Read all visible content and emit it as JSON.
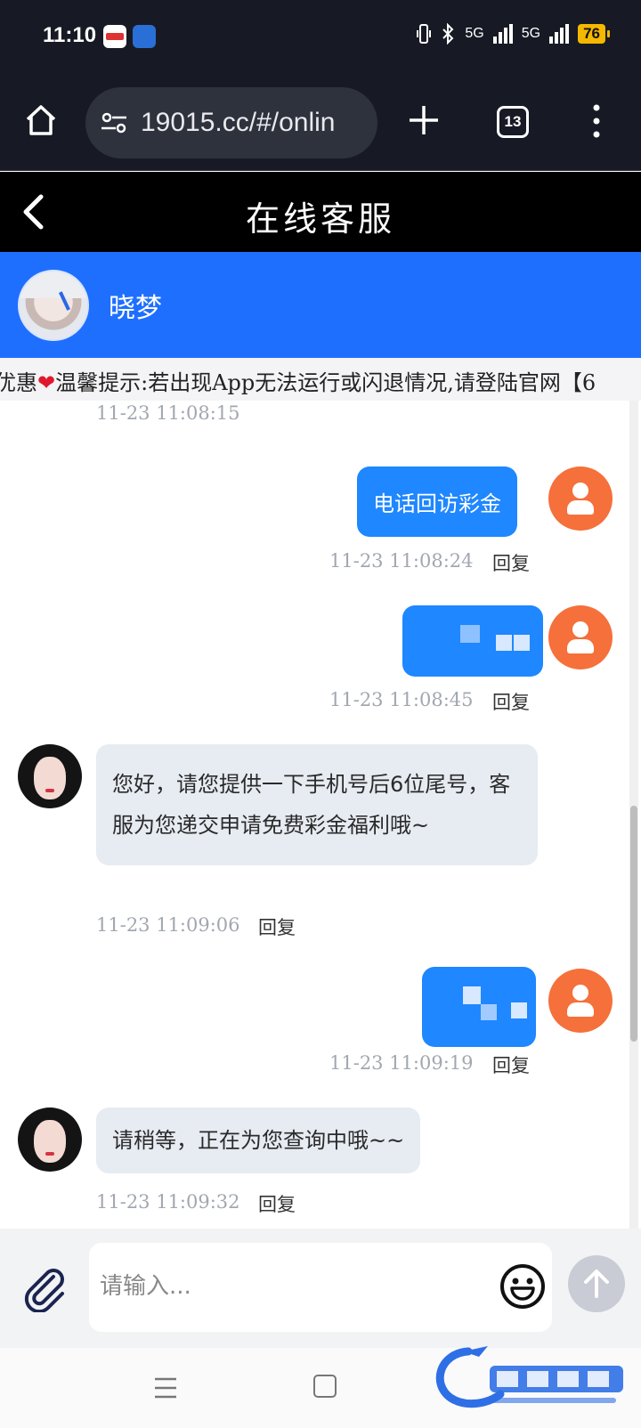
{
  "status_bar": {
    "time": "11:10",
    "battery": "76",
    "net_label_1": "5G",
    "net_label_2": "5G"
  },
  "browser": {
    "url": "19015.cc/#/onlin",
    "tab_count": "13"
  },
  "page": {
    "title": "在线客服"
  },
  "agent": {
    "name": "晓梦"
  },
  "marquee": {
    "prefix": "优惠",
    "text": "温馨提示:若出现App无法运行或闪退情况,请登陆官网【6"
  },
  "messages": [
    {
      "from": "agent",
      "time": "11-23 11:08:15"
    },
    {
      "from": "me",
      "text": "电话回访彩金",
      "time": "11-23 11:08:24",
      "reply": "回复"
    },
    {
      "from": "me",
      "text": "",
      "time": "11-23 11:08:45",
      "reply": "回复"
    },
    {
      "from": "agent",
      "text": "您好，请您提供一下手机号后6位尾号，客服为您递交申请免费彩金福利哦~",
      "time": "11-23 11:09:06",
      "reply": "回复"
    },
    {
      "from": "me",
      "text": "",
      "time": "11-23 11:09:19",
      "reply": "回复"
    },
    {
      "from": "agent",
      "text": "请稍等，正在为您查询中哦~~",
      "time": "11-23 11:09:32",
      "reply": "回复"
    }
  ],
  "composer": {
    "placeholder": "请输入..."
  },
  "icons": {
    "home": "home-icon",
    "url_settings": "tune-icon",
    "plus": "plus-icon",
    "tabs": "tabs-icon",
    "menu": "more-vert-icon",
    "back": "chevron-left-icon",
    "attach": "paperclip-icon",
    "emoji": "smiley-icon",
    "send": "arrow-up-icon"
  },
  "colors": {
    "primary": "#1f6fff",
    "bubble_me": "#1f87ff",
    "bubble_agent": "#e7ebf2",
    "user_avatar": "#f5703a"
  }
}
